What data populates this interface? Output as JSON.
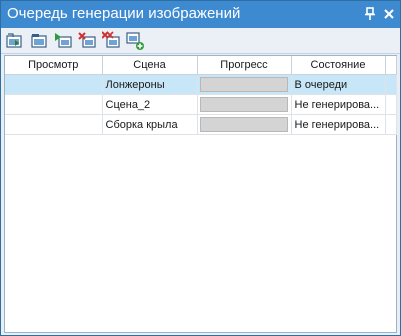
{
  "window": {
    "title": "Очередь генерации изображений",
    "pin_glyph": "⊥",
    "close_glyph": "×"
  },
  "toolbar": {
    "buttons": [
      {
        "name": "generate-all-icon"
      },
      {
        "name": "open-scene-icon"
      },
      {
        "name": "play-selected-icon"
      },
      {
        "name": "remove-selected-icon"
      },
      {
        "name": "remove-all-icon"
      },
      {
        "name": "add-scene-icon"
      }
    ]
  },
  "grid": {
    "columns": [
      "Просмотр",
      "Сцена",
      "Прогресс",
      "Состояние"
    ],
    "rows": [
      {
        "preview": "",
        "scene": "Лонжероны",
        "progress": 0,
        "state": "В очереди",
        "selected": true
      },
      {
        "preview": "",
        "scene": "Сцена_2",
        "progress": 0,
        "state": "Не генерирова...",
        "selected": false
      },
      {
        "preview": "",
        "scene": "Сборка крыла",
        "progress": 0,
        "state": "Не генерирова...",
        "selected": false
      }
    ]
  },
  "colors": {
    "title_bar": "#3d8ad1",
    "selected_row": "#c7e6f7",
    "progress_track": "#d4d4d4"
  }
}
